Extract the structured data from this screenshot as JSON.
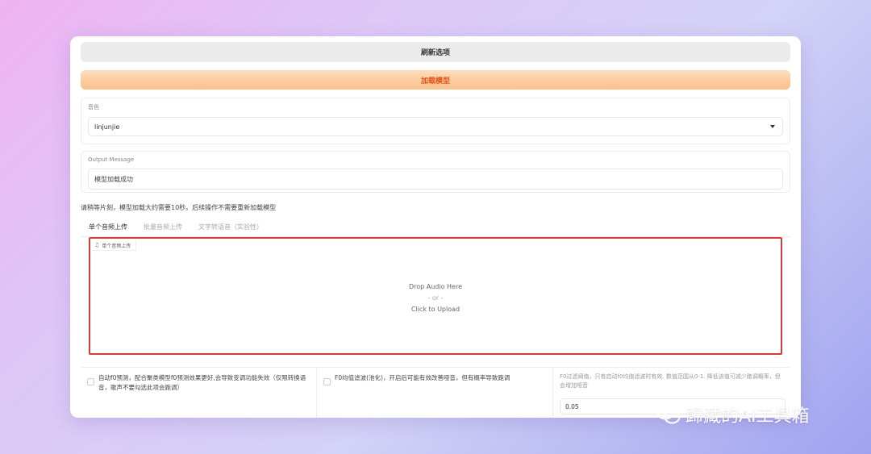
{
  "buttons": {
    "refresh_label": "刷新选项",
    "load_model_label": "加载模型"
  },
  "voice": {
    "label": "音色",
    "selected": "linjunjie"
  },
  "output": {
    "label": "Output Message",
    "value": "模型加载成功"
  },
  "notice": "请稍等片刻，模型加载大约需要10秒。后续操作不需要重新加载模型",
  "tabs": [
    {
      "label": "单个音频上传",
      "active": true
    },
    {
      "label": "批量音频上传",
      "active": false
    },
    {
      "label": "文字转语音（实验性）",
      "active": false
    }
  ],
  "upload": {
    "tag_label": "单个音频上传",
    "drop_text": "Drop Audio Here",
    "or_text": "- or -",
    "click_text": "Click to Upload"
  },
  "options": {
    "auto_predict_label": "自动f0预测，配合聚类模型f0预测效果更好,会导致变调功能失效（仅限转换语音，歌声不要勾选此项会跑调）",
    "f0_filter_label": "F0均值滤波(池化)，开启后可能有效改善哑音，但有概率导致跑调",
    "f0_threshold_label": "F0过滤阈值，只有启动f0均值滤波时有效. 数值范围从0-1. 降低该值可减少跑调概率，但会增加哑音",
    "f0_threshold_value": "0.05"
  },
  "watermark": {
    "text": "歸藏的AI工具箱",
    "icon": "wechat-icon"
  },
  "colors": {
    "load_button_text": "#e0521c",
    "drop_border": "#d63a3a"
  }
}
